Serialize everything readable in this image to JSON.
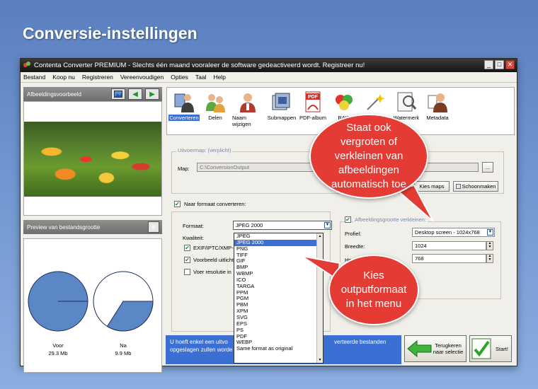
{
  "slide": {
    "title": "Conversie-instellingen"
  },
  "window": {
    "title": "Contenta Converter PREMIUM  -  Slechts één maand vooraleer de software gedeactiveerd wordt. Registreer nu!",
    "controls": {
      "minimize": "_",
      "maximize": "□",
      "close": "✕"
    }
  },
  "menu": [
    "Bestand",
    "Koop nu",
    "Registreren",
    "Vereenvoudigen",
    "Opties",
    "Taal",
    "Help"
  ],
  "left": {
    "preview_title": "Afbeeldingsvoorbeeld",
    "size_title": "Preview van bestandsgrootte",
    "pause_symbol": "II",
    "before_label": "Voor",
    "before_value": "29.3 Mb",
    "after_label": "Na",
    "after_value": "9.9 Mb",
    "after_fraction": 0.34
  },
  "toolbar": [
    {
      "label": "Converteren",
      "icon": "person-icon"
    },
    {
      "label": "Delen",
      "icon": "people-icon"
    },
    {
      "label": "Naam wijzigen",
      "icon": "person-rename-icon"
    },
    {
      "label": "Submappen",
      "icon": "folders-icon"
    },
    {
      "label": "PDF-album",
      "icon": "pdf-icon"
    },
    {
      "label": "RAW",
      "icon": "raw-icon"
    },
    {
      "label": "",
      "icon": "effects-icon"
    },
    {
      "label": "Watermerk",
      "icon": "watermark-icon"
    },
    {
      "label": "Metadata",
      "icon": "metadata-icon"
    }
  ],
  "output": {
    "group_label": "Uitvoermap: (verplicht)",
    "map_label": "Map:",
    "map_value": "C:\\ConversionOutput",
    "browse": "...",
    "kies_maps": "Kies maps",
    "schoonmaken": "Schoonmaken"
  },
  "format": {
    "convert_label": "Naar formaat converteren:",
    "format_label": "Formaat:",
    "format_value": "JPEG 2000",
    "quality_label": "Kwaliteit:",
    "exif_label": "EXIF/IPTC/XMP-i",
    "preview_label": "Voorbeeld uitlicht",
    "resolution_label": "Voer resolutie in",
    "options": [
      "JPEG",
      "JPEG 2000",
      "PNG",
      "TIFF",
      "GIF",
      "BMP",
      "WBMP",
      "ICO",
      "TARGA",
      "PPM",
      "PGM",
      "PBM",
      "XPM",
      "SVG",
      "EPS",
      "PS",
      "PDF",
      "WEBP",
      "Same format as original"
    ],
    "selected_index": 1
  },
  "resize": {
    "label": "Afbeeldingsgrootte verkleinen:",
    "profile_label": "Profiel:",
    "profile_value": "Desktop screen - 1024x768",
    "width_label": "Breedte:",
    "width_value": "1024",
    "height_label": "Hoogte:",
    "height_value": "768"
  },
  "info": {
    "text_left": "U hoeft enkel een uitvo",
    "text_left2": "opgeslagen zullen worde",
    "text_right": "verteerde bestanden"
  },
  "buttons": {
    "back": "Terugkeren naar selectie",
    "start": "Start!"
  },
  "bubbles": {
    "top": "Staat ook vergroten of verkleinen van afbeeldingen automatisch toe",
    "bottom": "Kies outputformaat in het menu"
  }
}
